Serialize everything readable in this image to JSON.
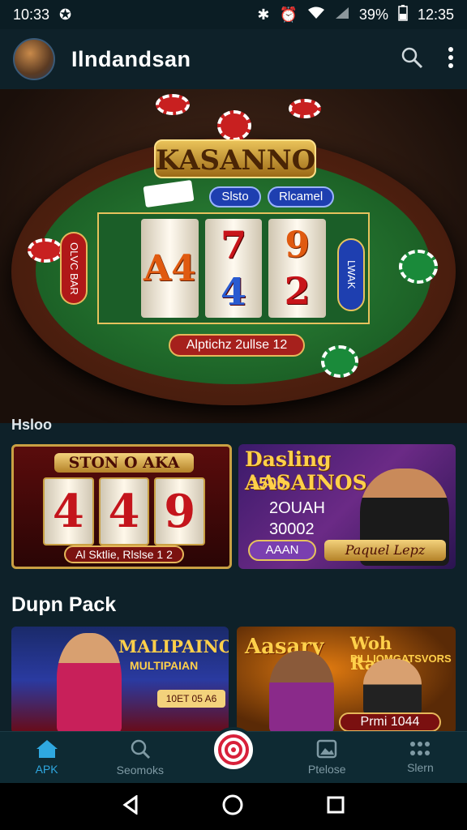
{
  "status_bar": {
    "time_left": "10:33",
    "battery": "39%",
    "time_right": "12:35"
  },
  "app_bar": {
    "title": "Ilndandsan"
  },
  "hero": {
    "logo": "KASANNO",
    "pill_left": "Slsto",
    "pill_right": "Rlcamel",
    "reel1_top": "A4",
    "reel2_top": "7",
    "reel3_top": "9",
    "reel2_bottom": "4",
    "reel3_bottom": "2",
    "side_left": "OLVC BAR",
    "side_right": "LWAK",
    "jackpot": "Alptichz 2ullse 12"
  },
  "section_label": "Hsloo",
  "card_slot": {
    "title": "STON O AKA",
    "reels": [
      "4",
      "4",
      "9"
    ],
    "footer": "Al Sktlie, Rlslse 1 2"
  },
  "card_dealer": {
    "title": "Dasling AASAINOS",
    "line1": "1500",
    "line2": "2OUAH",
    "line3": "30002",
    "button": "AAAN",
    "tag": "Paquel Lepz"
  },
  "section_title": "Dupn Pack",
  "card_billiard": {
    "title": "MALIPAINOS",
    "subtitle": "MULTIPAIAN",
    "tag": "10ET 05 A6"
  },
  "card_party": {
    "title": "Aasary",
    "title2": "Woh Ranne",
    "subtitle": "PILLIOMGATSVORS",
    "tag": "Prmi 1044"
  },
  "bottom_nav": [
    {
      "label": "APK",
      "icon": "home-icon"
    },
    {
      "label": "Seomoks",
      "icon": "search-icon"
    },
    {
      "label": "Ptelose",
      "icon": "photo-icon"
    },
    {
      "label": "Slern",
      "icon": "grid-icon"
    }
  ],
  "colors": {
    "background": "#0e2129",
    "accent": "#2fa8e0",
    "gold": "#e6c25d",
    "felt": "#2f8a3a"
  }
}
